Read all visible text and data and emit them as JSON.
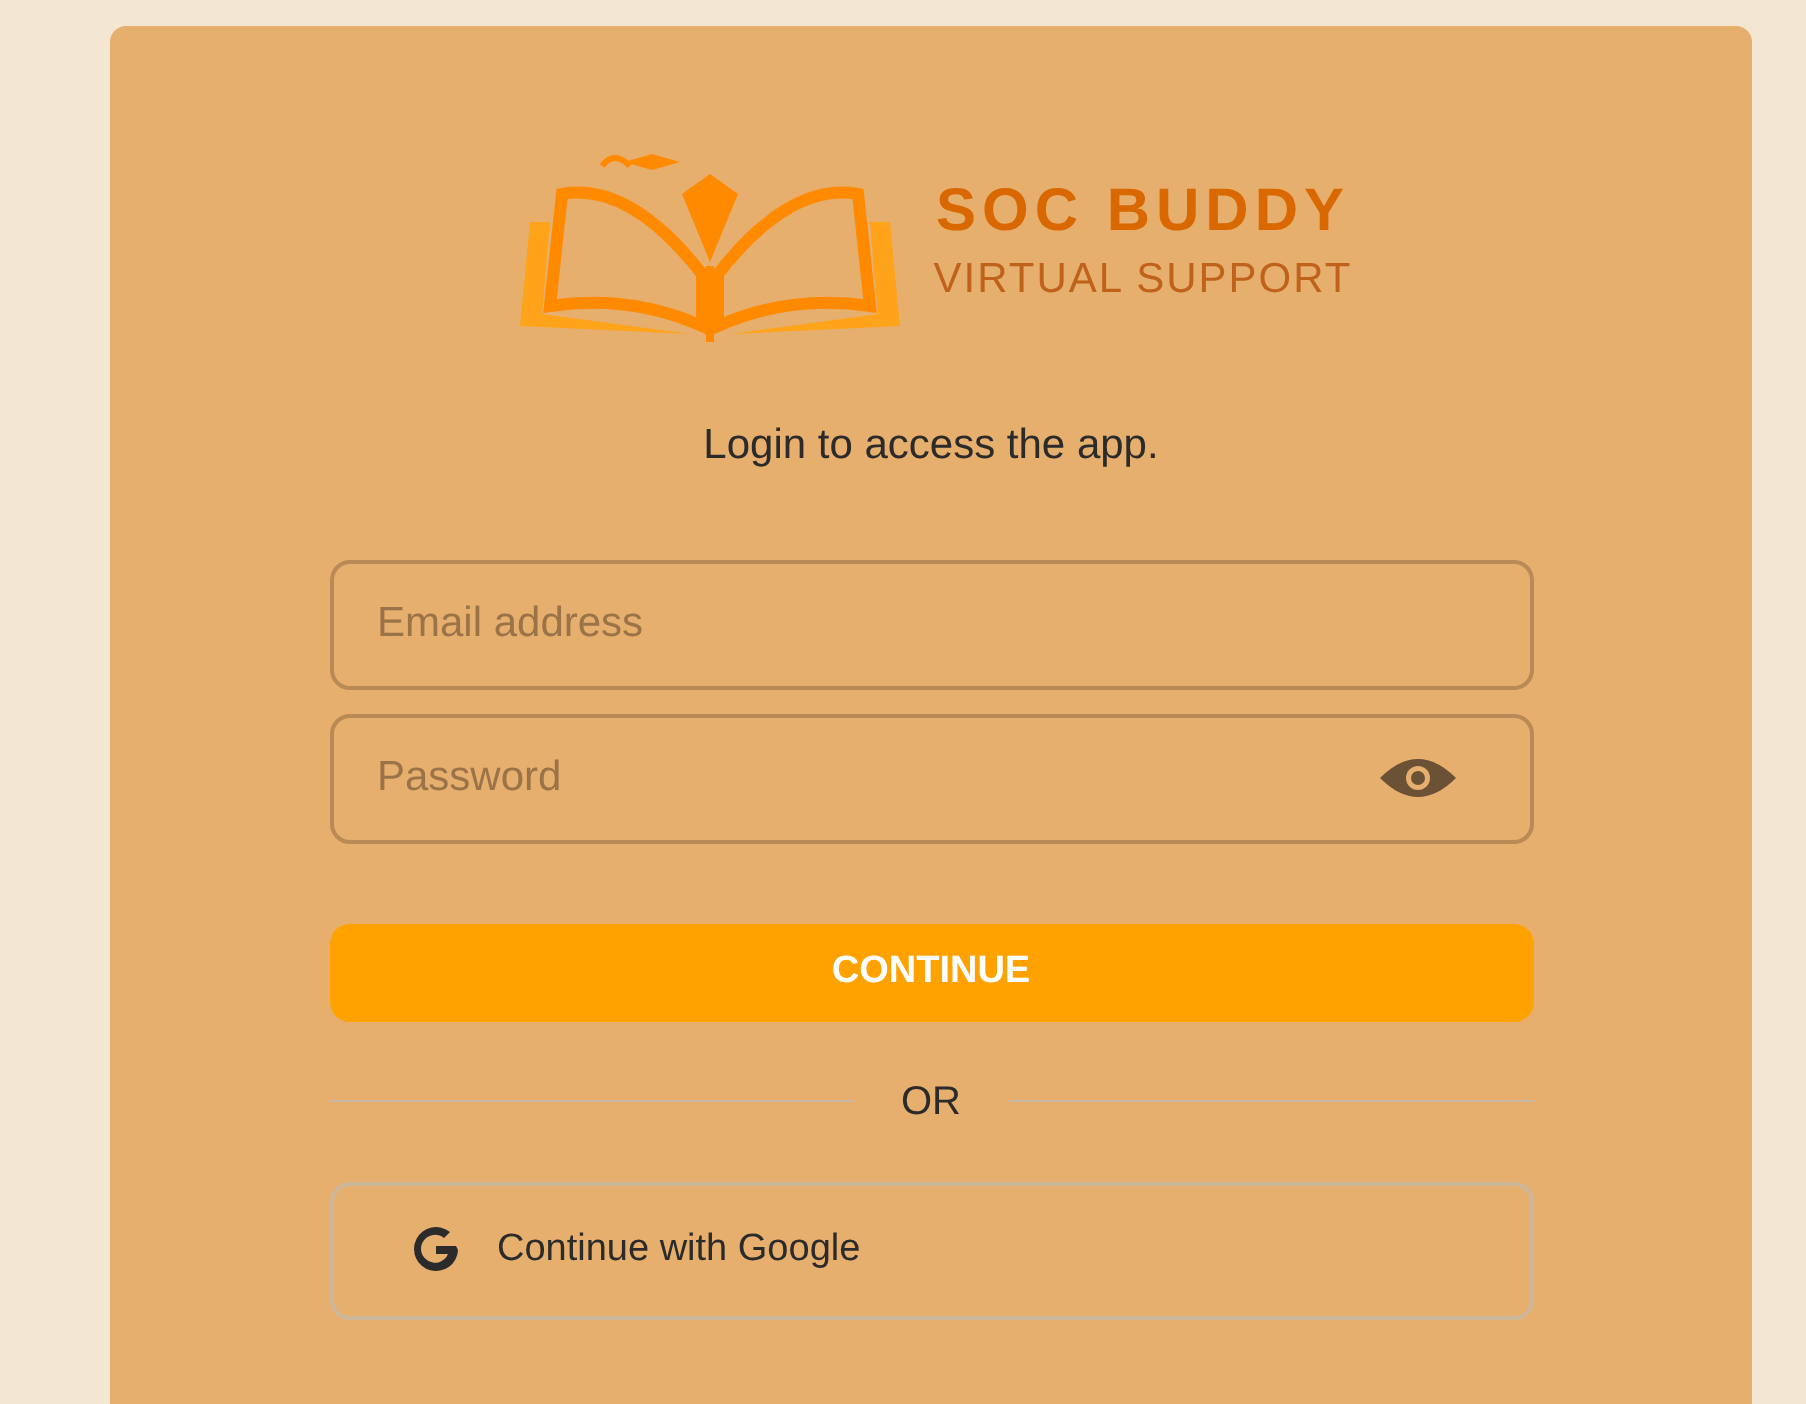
{
  "logo": {
    "title": "SOC BUDDY",
    "subtitle": "VIRTUAL SUPPORT"
  },
  "prompt": "Login to access the app.",
  "fields": [
    {
      "kind": "email",
      "placeholder": "Email address"
    },
    {
      "kind": "password",
      "placeholder": "Password"
    }
  ],
  "primary_button": "CONTINUE",
  "divider": "OR",
  "google_button": "Continue with Google"
}
